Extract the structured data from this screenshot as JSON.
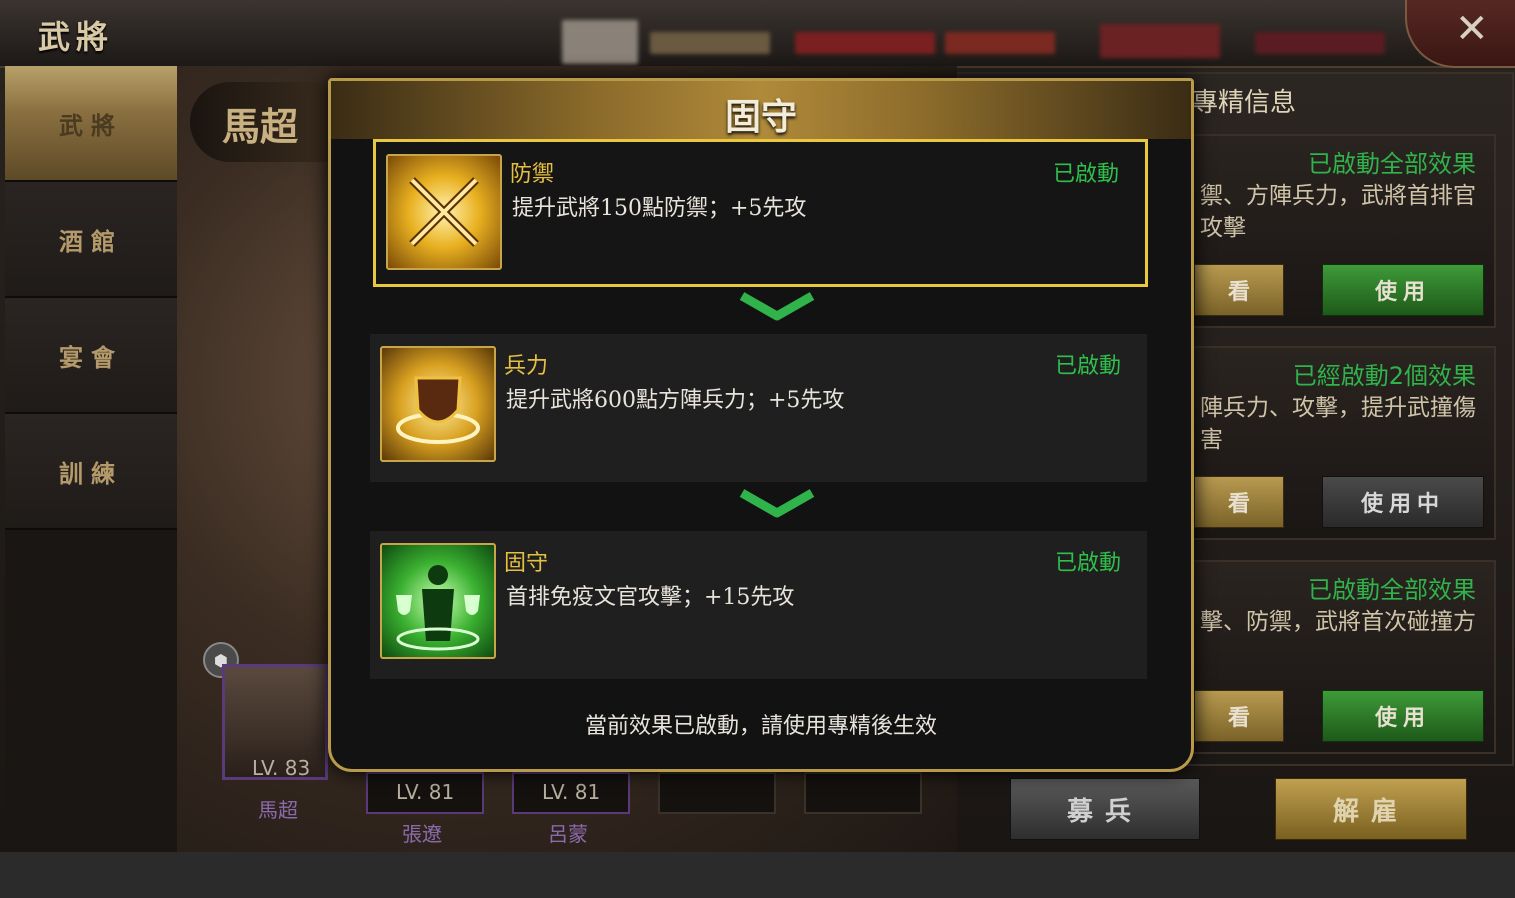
{
  "header": {
    "title": "武將",
    "close_icon": "close-icon"
  },
  "nav": {
    "items": [
      {
        "label": "武將",
        "active": true
      },
      {
        "label": "酒館",
        "active": false
      },
      {
        "label": "宴會",
        "active": false
      },
      {
        "label": "訓練",
        "active": false
      }
    ]
  },
  "general": {
    "name": "馬超",
    "portraits": [
      {
        "level": "LV. 83",
        "name": "馬超"
      },
      {
        "level": "LV. 81",
        "name": "張遼"
      },
      {
        "level": "LV. 81",
        "name": "呂蒙"
      }
    ]
  },
  "right_panel": {
    "title": "專精信息",
    "cards": [
      {
        "status": "已啟動全部效果",
        "text": "禦、方陣兵力，武將首排官攻擊",
        "view_label": "看",
        "action_label": "使用",
        "action_state": "use"
      },
      {
        "status": "已經啟動2個效果",
        "text": "陣兵力、攻擊，提升武撞傷害",
        "view_label": "看",
        "action_label": "使用中",
        "action_state": "in_use"
      },
      {
        "status": "已啟動全部效果",
        "text": "擊、防禦，武將首次碰撞方",
        "view_label": "看",
        "action_label": "使用",
        "action_state": "use"
      }
    ],
    "recruit_label": "募兵",
    "dismiss_label": "解雇"
  },
  "modal": {
    "title": "固守",
    "effects": [
      {
        "name": "防禦",
        "description": "提升武將150點防禦；+5先攻",
        "status": "已啟動",
        "icon": "crossed-swords-icon",
        "highlighted": true
      },
      {
        "name": "兵力",
        "description": "提升武將600點方陣兵力；+5先攻",
        "status": "已啟動",
        "icon": "shield-icon",
        "highlighted": false
      },
      {
        "name": "固守",
        "description": "首排免疫文官攻擊；+15先攻",
        "status": "已啟動",
        "icon": "guard-figure-icon",
        "highlighted": false
      }
    ],
    "note": "當前效果已啟動，請使用專精後生效"
  },
  "colors": {
    "accent_gold": "#e8c840",
    "status_green": "#2fc04c",
    "modal_bg": "#121212"
  }
}
